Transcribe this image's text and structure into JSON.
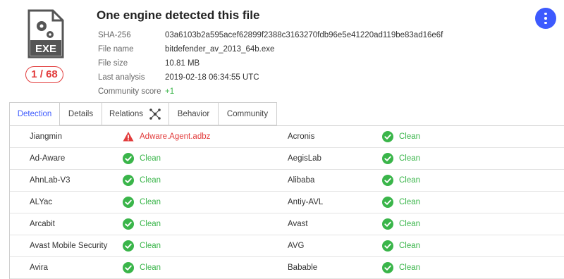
{
  "file": {
    "title": "One engine detected this file",
    "icon_label": "EXE",
    "score": "1 / 68",
    "meta": [
      {
        "label": "SHA-256",
        "value": "03a6103b2a595acef62899f2388c3163270fdb96e5e41220ad119be83ad16e6f"
      },
      {
        "label": "File name",
        "value": "bitdefender_av_2013_64b.exe"
      },
      {
        "label": "File size",
        "value": "10.81 MB"
      },
      {
        "label": "Last analysis",
        "value": "2019-02-18 06:34:55 UTC"
      },
      {
        "label": "Community score",
        "value": "+1"
      }
    ]
  },
  "tabs": [
    {
      "label": "Detection",
      "active": true
    },
    {
      "label": "Details"
    },
    {
      "label": "Relations"
    },
    {
      "label": "Behavior"
    },
    {
      "label": "Community"
    }
  ],
  "detections": [
    {
      "left": {
        "engine": "Jiangmin",
        "result": "Adware.Agent.adbz",
        "status": "detected"
      },
      "right": {
        "engine": "Acronis",
        "result": "Clean",
        "status": "clean"
      }
    },
    {
      "left": {
        "engine": "Ad-Aware",
        "result": "Clean",
        "status": "clean"
      },
      "right": {
        "engine": "AegisLab",
        "result": "Clean",
        "status": "clean"
      }
    },
    {
      "left": {
        "engine": "AhnLab-V3",
        "result": "Clean",
        "status": "clean"
      },
      "right": {
        "engine": "Alibaba",
        "result": "Clean",
        "status": "clean"
      }
    },
    {
      "left": {
        "engine": "ALYac",
        "result": "Clean",
        "status": "clean"
      },
      "right": {
        "engine": "Antiy-AVL",
        "result": "Clean",
        "status": "clean"
      }
    },
    {
      "left": {
        "engine": "Arcabit",
        "result": "Clean",
        "status": "clean"
      },
      "right": {
        "engine": "Avast",
        "result": "Clean",
        "status": "clean"
      }
    },
    {
      "left": {
        "engine": "Avast Mobile Security",
        "result": "Clean",
        "status": "clean"
      },
      "right": {
        "engine": "AVG",
        "result": "Clean",
        "status": "clean"
      }
    },
    {
      "left": {
        "engine": "Avira",
        "result": "Clean",
        "status": "clean"
      },
      "right": {
        "engine": "Babable",
        "result": "Clean",
        "status": "clean"
      }
    }
  ],
  "colors": {
    "accent": "#3d5afe",
    "clean": "#3ab54a",
    "detected": "#e23c3c"
  }
}
